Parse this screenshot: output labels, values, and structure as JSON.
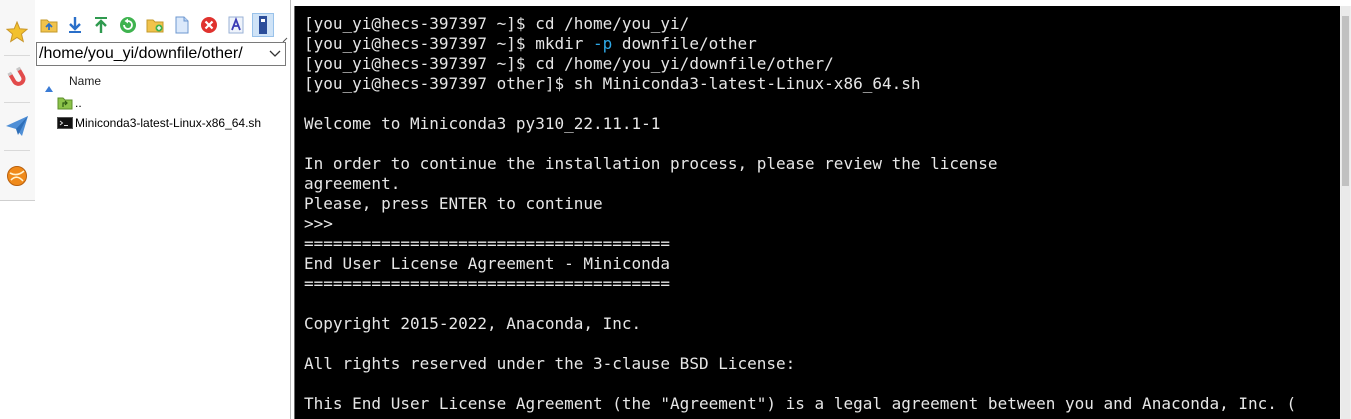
{
  "file_panel": {
    "path_value": "/home/you_yi/downfile/other/",
    "column_name": "Name",
    "files": [
      {
        "name": "..",
        "icon": "parent-folder-icon"
      },
      {
        "name": "Miniconda3-latest-Linux-x86_64.sh",
        "icon": "shell-script-icon"
      }
    ],
    "toolbar_icons": [
      "upload-folder-icon",
      "download-icon",
      "upload-icon",
      "refresh-icon",
      "new-folder-icon",
      "new-file-icon",
      "delete-icon",
      "rename-icon",
      "view-toggle-icon"
    ]
  },
  "rail_icons": [
    "star-icon",
    "magnet-icon",
    "paper-plane-icon",
    "orange-ball-icon"
  ],
  "terminal": {
    "lines": [
      {
        "segments": [
          {
            "text": "[you_yi@hecs-397397 ~]$ cd /home/you_yi/"
          }
        ]
      },
      {
        "segments": [
          {
            "text": "[you_yi@hecs-397397 ~]$ mkdir "
          },
          {
            "text": "-p",
            "class": "opt"
          },
          {
            "text": " downfile/other"
          }
        ]
      },
      {
        "segments": [
          {
            "text": "[you_yi@hecs-397397 ~]$ cd /home/you_yi/downfile/other/"
          }
        ]
      },
      {
        "segments": [
          {
            "text": "[you_yi@hecs-397397 other]$ sh Miniconda3-latest-Linux-x86_64.sh"
          }
        ]
      },
      {
        "segments": [
          {
            "text": ""
          }
        ]
      },
      {
        "segments": [
          {
            "text": "Welcome to Miniconda3 py310_22.11.1-1"
          }
        ]
      },
      {
        "segments": [
          {
            "text": ""
          }
        ]
      },
      {
        "segments": [
          {
            "text": "In order to continue the installation process, please review the license"
          }
        ]
      },
      {
        "segments": [
          {
            "text": "agreement."
          }
        ]
      },
      {
        "segments": [
          {
            "text": "Please, press ENTER to continue"
          }
        ]
      },
      {
        "segments": [
          {
            "text": ">>>"
          }
        ]
      },
      {
        "segments": [
          {
            "text": "======================================"
          }
        ]
      },
      {
        "segments": [
          {
            "text": "End User License Agreement - Miniconda"
          }
        ]
      },
      {
        "segments": [
          {
            "text": "======================================"
          }
        ]
      },
      {
        "segments": [
          {
            "text": ""
          }
        ]
      },
      {
        "segments": [
          {
            "text": "Copyright 2015-2022, Anaconda, Inc."
          }
        ]
      },
      {
        "segments": [
          {
            "text": ""
          }
        ]
      },
      {
        "segments": [
          {
            "text": "All rights reserved under the 3-clause BSD License:"
          }
        ]
      },
      {
        "segments": [
          {
            "text": ""
          }
        ]
      },
      {
        "segments": [
          {
            "text": "This End User License Agreement (the \"Agreement\") is a legal agreement between you and Anaconda, Inc. ("
          }
        ]
      }
    ]
  },
  "colors": {
    "terminal_bg": "#000000",
    "terminal_fg": "#e6e6e6",
    "option_blue": "#2ea8e6"
  }
}
